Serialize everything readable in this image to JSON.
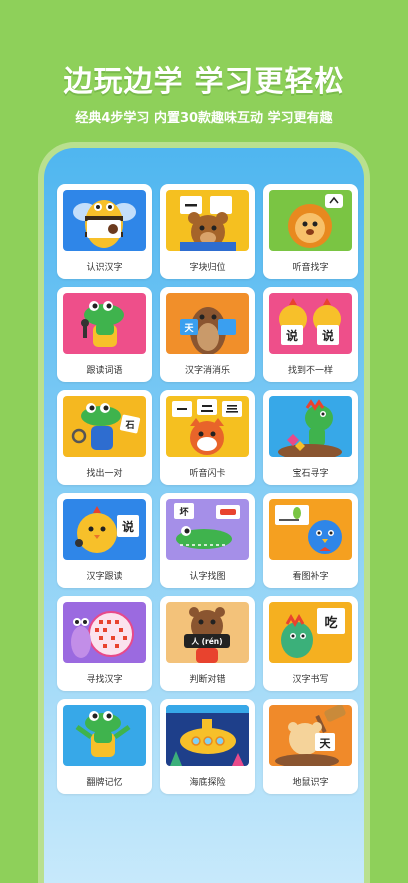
{
  "header": {
    "title": "边玩边学 学习更轻松",
    "subtitle": "经典4步学习 内置30款趣味互动 学习更有趣"
  },
  "colors": {
    "background": "#8ed05a",
    "phone_frame": "#b9e08f",
    "screen_top": "#4fb6f0",
    "card": "#ffffff"
  },
  "games": [
    {
      "label": "认识汉字",
      "icon": "bee-bear-icon",
      "thumb_color": "#2f86e8",
      "card_text": "熊"
    },
    {
      "label": "字块归位",
      "icon": "bear-blocks-icon",
      "thumb_color": "#f5c020",
      "card_text": "一"
    },
    {
      "label": "听音找字",
      "icon": "lion-icon",
      "thumb_color": "#7ac543",
      "card_text": "^"
    },
    {
      "label": "跟读词语",
      "icon": "crocodile-singer-icon",
      "thumb_color": "#ee4f8a",
      "card_text": ""
    },
    {
      "label": "汉字消消乐",
      "icon": "beaver-icon",
      "thumb_color": "#f18f2a",
      "card_text": "天"
    },
    {
      "label": "找到不一样",
      "icon": "twin-chicks-icon",
      "thumb_color": "#ee4f8a",
      "card_text": "说"
    },
    {
      "label": "找出一对",
      "icon": "crocodile-magnifier-icon",
      "thumb_color": "#f5b820",
      "card_text": "石"
    },
    {
      "label": "听音闪卡",
      "icon": "fox-cards-icon",
      "thumb_color": "#f5c020",
      "card_text": "一 二 三"
    },
    {
      "label": "宝石寻字",
      "icon": "dinosaur-gems-icon",
      "thumb_color": "#37a8e8",
      "card_text": ""
    },
    {
      "label": "汉字跟读",
      "icon": "chick-card-icon",
      "thumb_color": "#2f86e8",
      "card_text": "说"
    },
    {
      "label": "认字找图",
      "icon": "crocodile-car-icon",
      "thumb_color": "#a58fe8",
      "card_text": "坏"
    },
    {
      "label": "看图补字",
      "icon": "bluebird-icon",
      "thumb_color": "#f5a020",
      "card_text": "一个种子"
    },
    {
      "label": "寻找汉字",
      "icon": "snail-icon",
      "thumb_color": "#9b6ae0",
      "card_text": ""
    },
    {
      "label": "判断对错",
      "icon": "bear-sign-icon",
      "thumb_color": "#f3c27a",
      "card_text": "人 (rén)"
    },
    {
      "label": "汉字书写",
      "icon": "dinosaur-writing-icon",
      "thumb_color": "#f5b020",
      "card_text": "吃"
    },
    {
      "label": "翻牌记忆",
      "icon": "crocodile-cheer-icon",
      "thumb_color": "#37a8e8",
      "card_text": ""
    },
    {
      "label": "海底探险",
      "icon": "submarine-icon",
      "thumb_color": "#1e3f8a",
      "card_text": ""
    },
    {
      "label": "地鼠识字",
      "icon": "hamster-hammer-icon",
      "thumb_color": "#f08a2a",
      "card_text": "天"
    }
  ]
}
